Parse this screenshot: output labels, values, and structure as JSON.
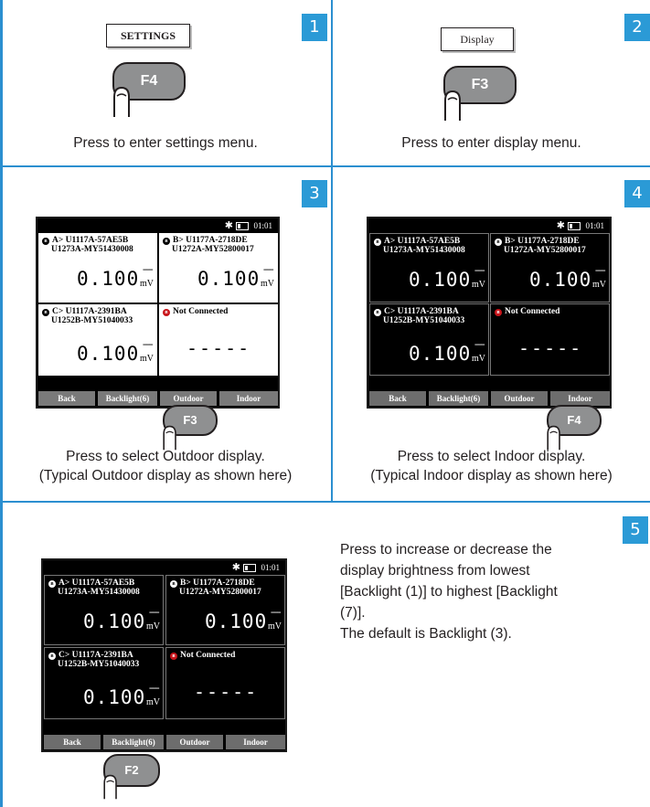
{
  "colors": {
    "accent": "#2b8fd0",
    "step_badge": "#2b9ad6",
    "key_cap": "#8f9091",
    "bt_red": "#c8151b"
  },
  "step1": {
    "number": "1",
    "menu_label": "SETTINGS",
    "key": "F4",
    "caption": "Press to enter settings menu."
  },
  "step2": {
    "number": "2",
    "menu_label": "Display",
    "key": "F3",
    "caption": "Press to enter display menu."
  },
  "step3": {
    "number": "3",
    "key": "F3",
    "caption_line1": "Press to select Outdoor display.",
    "caption_line2": "(Typical Outdoor display as shown here)"
  },
  "step4": {
    "number": "4",
    "key": "F4",
    "caption_line1": "Press to select Indoor display.",
    "caption_line2": "(Typical Indoor display as shown here)"
  },
  "step5": {
    "number": "5",
    "key": "F2",
    "desc_lines": [
      "Press to increase or decrease the",
      "display brightness from lowest",
      "[Backlight (1)] to highest [Backlight",
      "(7)].",
      "The default is Backlight (3)."
    ]
  },
  "screen": {
    "star": "✱",
    "time": "01:01",
    "bt_symbol": "ʙ",
    "panel_a": {
      "line1": "A> U1117A-57AE5B",
      "line2": "U1273A-MY51430008",
      "value": "0.100",
      "unit": "mV",
      "dc": "==="
    },
    "panel_b": {
      "line1": "B> U1177A-2718DE",
      "line2": "U1272A-MY52800017",
      "value": "0.100",
      "unit": "mV",
      "dc": "==="
    },
    "panel_c": {
      "line1": "C> U1117A-2391BA",
      "line2": "U1252B-MY51040033",
      "value": "0.100",
      "unit": "mV",
      "dc": "==="
    },
    "panel_d": {
      "line1": "Not Connected",
      "dashes": "-----"
    },
    "softkeys": [
      "Back",
      "Backlight(6)",
      "Outdoor",
      "Indoor"
    ]
  }
}
